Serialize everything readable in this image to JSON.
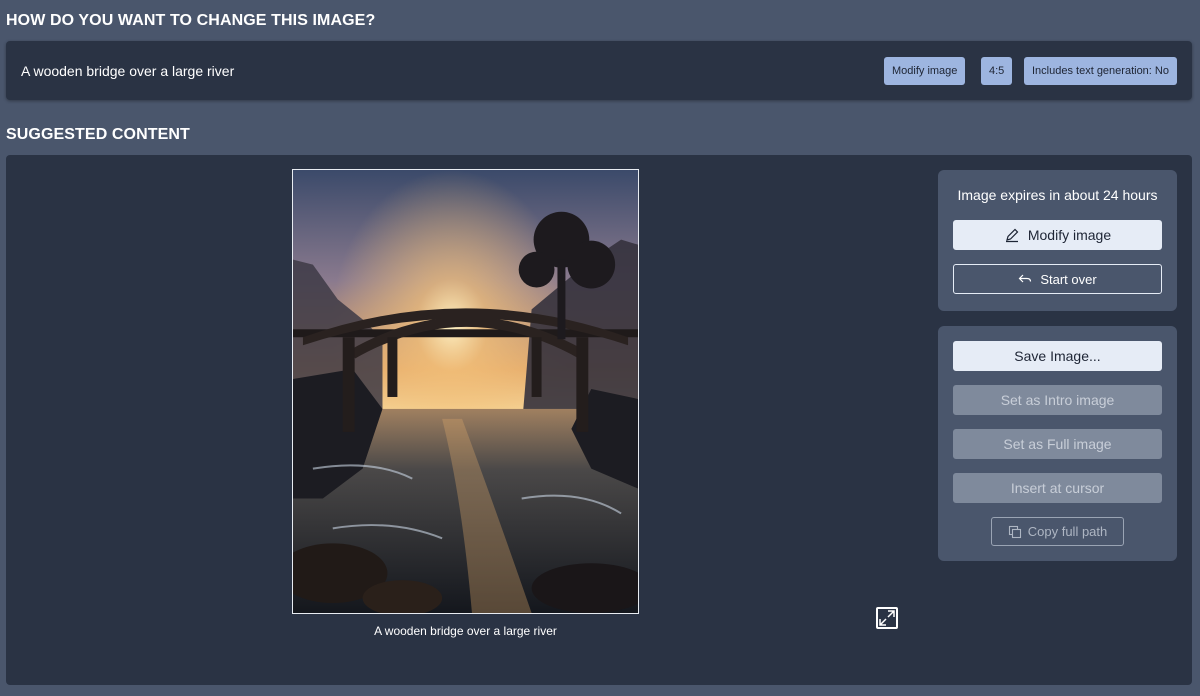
{
  "header": {
    "change_title": "HOW DO YOU WANT TO CHANGE THIS IMAGE?",
    "suggested_title": "SUGGESTED CONTENT"
  },
  "prompt": {
    "text": "A wooden bridge over a large river",
    "chips": [
      "Modify image",
      "4:5",
      "Includes text generation: No"
    ]
  },
  "image": {
    "caption": "A wooden bridge over a large river",
    "icon": "landscape-photo"
  },
  "side_panel": {
    "expires_text": "Image expires in about 24 hours",
    "modify_label": "Modify image",
    "start_over_label": "Start over",
    "save_label": "Save Image...",
    "intro_label": "Set as Intro image",
    "full_label": "Set as Full image",
    "insert_label": "Insert at cursor",
    "copy_label": "Copy full path"
  },
  "colors": {
    "background": "#4a566c",
    "panel": "#2a3344",
    "chip": "#9db5e0",
    "primary_button": "#e6ecf6",
    "disabled_button": "#7f8a9c"
  }
}
